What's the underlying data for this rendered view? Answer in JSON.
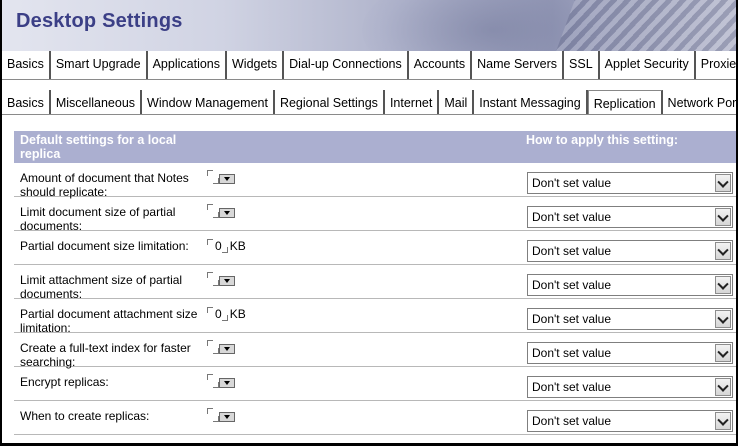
{
  "window": {
    "title": "Desktop Settings"
  },
  "primary_tabs": [
    "Basics",
    "Smart Upgrade",
    "Applications",
    "Widgets",
    "Dial-up Connections",
    "Accounts",
    "Name Servers",
    "SSL",
    "Applet Security",
    "Proxies"
  ],
  "secondary_tabs": [
    "Basics",
    "Miscellaneous",
    "Window Management",
    "Regional Settings",
    "Internet",
    "Mail",
    "Instant Messaging",
    "Replication",
    "Network Port"
  ],
  "active_secondary_tab": "Replication",
  "section": {
    "heading": "Default settings for a local replica",
    "apply_heading": "How to apply this setting:"
  },
  "rows": [
    {
      "label": "Amount of document that Notes should replicate:",
      "apply": "Don't set value"
    },
    {
      "label": "Limit document size of partial documents:",
      "apply": "Don't set value"
    },
    {
      "label": "Partial document size limitation:",
      "value": "0",
      "unit": "KB",
      "apply": "Don't set value"
    },
    {
      "label": "Limit attachment size of partial documents:",
      "apply": "Don't set value"
    },
    {
      "label": "Partial document attachment size limitation:",
      "value": "0",
      "unit": "KB",
      "apply": "Don't set value"
    },
    {
      "label": "Create a full-text index for faster searching:",
      "apply": "Don't set value"
    },
    {
      "label": "Encrypt replicas:",
      "apply": "Don't set value"
    },
    {
      "label": "When to create replicas:",
      "apply": "Don't set value"
    }
  ],
  "icons": {
    "dropdown": "chevron-down-icon",
    "field_bracket": "field-bracket-icon"
  },
  "colors": {
    "title": "#3b3f86",
    "section_header_bg": "#abafd0",
    "section_header_text": "#ffffff"
  }
}
